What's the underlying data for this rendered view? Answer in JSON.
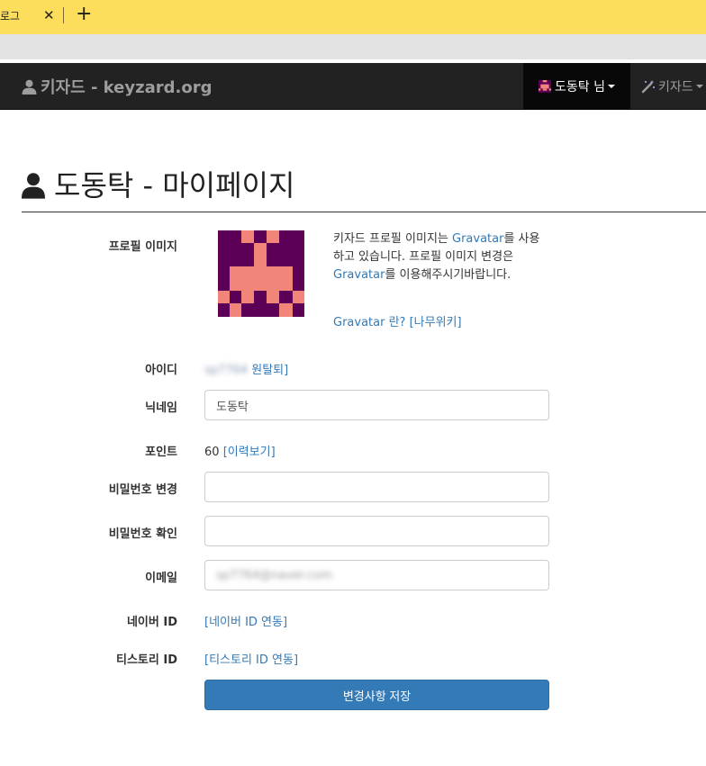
{
  "browser": {
    "tab_title": "로그",
    "tab_close": "✕",
    "new_tab": "+"
  },
  "navbar": {
    "brand": "키자드 - keyzard.org",
    "user_menu": "도동탁 님",
    "tools_menu": "키자드"
  },
  "page": {
    "title": "도동탁 - 마이페이지"
  },
  "form": {
    "profile_image_label": "프로필 이미지",
    "gravatar_text_1": "키자드 프로필 이미지는 ",
    "gravatar_link_1": "Gravatar",
    "gravatar_text_2": "를 사용하고 있습니다. 프로필 이미지 변경은 ",
    "gravatar_link_2": "Gravatar",
    "gravatar_text_3": "를 이용해주시기바랍니다.",
    "gravatar_about": "Gravatar 란? [나무위키]",
    "id_label": "아이디",
    "id_value": "sp7764",
    "withdraw_link": "원탈퇴]",
    "nickname_label": "닉네임",
    "nickname_value": "도동탁",
    "point_label": "포인트",
    "point_value": "60",
    "history_link": "[이력보기]",
    "password_label": "비밀번호 변경",
    "password_value": "",
    "password_confirm_label": "비밀번호 확인",
    "password_confirm_value": "",
    "email_label": "이메일",
    "email_value": "sp7764@naver.com",
    "naver_label": "네이버 ID",
    "naver_link": "[네이버 ID 연동]",
    "tistory_label": "티스토리 ID",
    "tistory_link": "[티스토리 ID 연동]",
    "save_button": "변경사항 저장"
  },
  "colors": {
    "navbar_bg": "#222222",
    "tab_bg": "#fdde5c",
    "link": "#337ab7",
    "primary_button": "#337ab7",
    "avatar_bg": "#5c0057",
    "avatar_fg": "#f2857a"
  }
}
